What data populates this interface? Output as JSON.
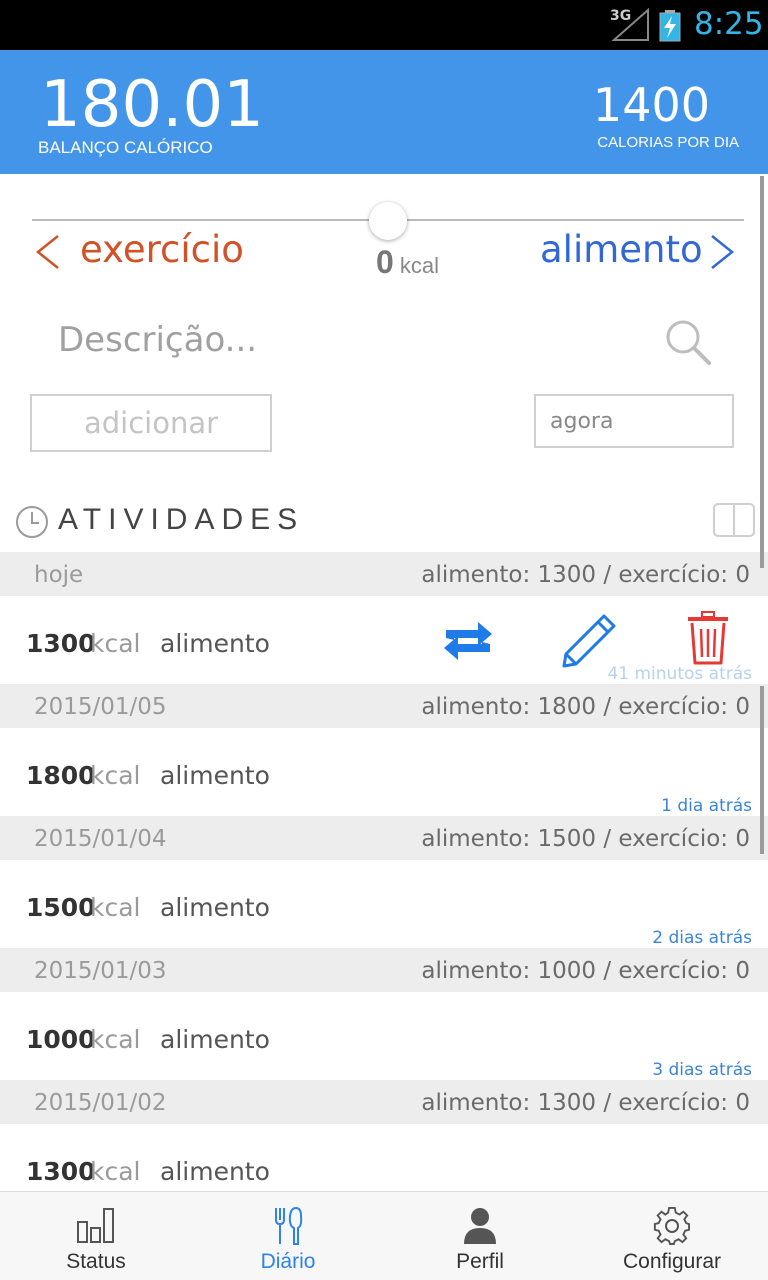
{
  "status_bar": {
    "network": "3G",
    "time": "8:25"
  },
  "header": {
    "balance_value": "180.01",
    "balance_label": "BALANÇO CALÓRICO",
    "daily_value": "1400",
    "daily_label": "CALORIAS POR DIA"
  },
  "entry_form": {
    "exercise_label": "exercício",
    "food_label": "alimento",
    "kcal_value": "0",
    "kcal_unit": "kcal",
    "slider_position": 0.5,
    "description_placeholder": "Descrição...",
    "add_button": "adicionar",
    "time_value": "agora"
  },
  "activities": {
    "title": "ATIVIDADES",
    "days": [
      {
        "date": "hoje",
        "summary": "alimento: 1300 / exercício: 0",
        "entry": {
          "value": "1300",
          "unit": "kcal",
          "type": "alimento",
          "ago": "41 minutos atrás"
        }
      },
      {
        "date": "2015/01/05",
        "summary": "alimento: 1800 / exercício: 0",
        "entry": {
          "value": "1800",
          "unit": "kcal",
          "type": "alimento",
          "ago": "1 dia atrás"
        }
      },
      {
        "date": "2015/01/04",
        "summary": "alimento: 1500 / exercício: 0",
        "entry": {
          "value": "1500",
          "unit": "kcal",
          "type": "alimento",
          "ago": "2 dias atrás"
        }
      },
      {
        "date": "2015/01/03",
        "summary": "alimento: 1000 / exercício: 0",
        "entry": {
          "value": "1000",
          "unit": "kcal",
          "type": "alimento",
          "ago": "3 dias atrás"
        }
      },
      {
        "date": "2015/01/02",
        "summary": "alimento: 1300 / exercício: 0",
        "entry": {
          "value": "1300",
          "unit": "kcal",
          "type": "alimento",
          "ago": ""
        }
      }
    ]
  },
  "bottom_nav": {
    "items": [
      {
        "label": "Status",
        "icon": "bar-chart-icon"
      },
      {
        "label": "Diário",
        "icon": "fork-knife-icon",
        "active": true
      },
      {
        "label": "Perfil",
        "icon": "person-icon"
      },
      {
        "label": "Configurar",
        "icon": "gear-icon"
      }
    ]
  },
  "colors": {
    "header": "#4395ea",
    "exercise": "#d35126",
    "food": "#3168d5",
    "accent": "#2d83ea",
    "delete": "#e53935"
  }
}
